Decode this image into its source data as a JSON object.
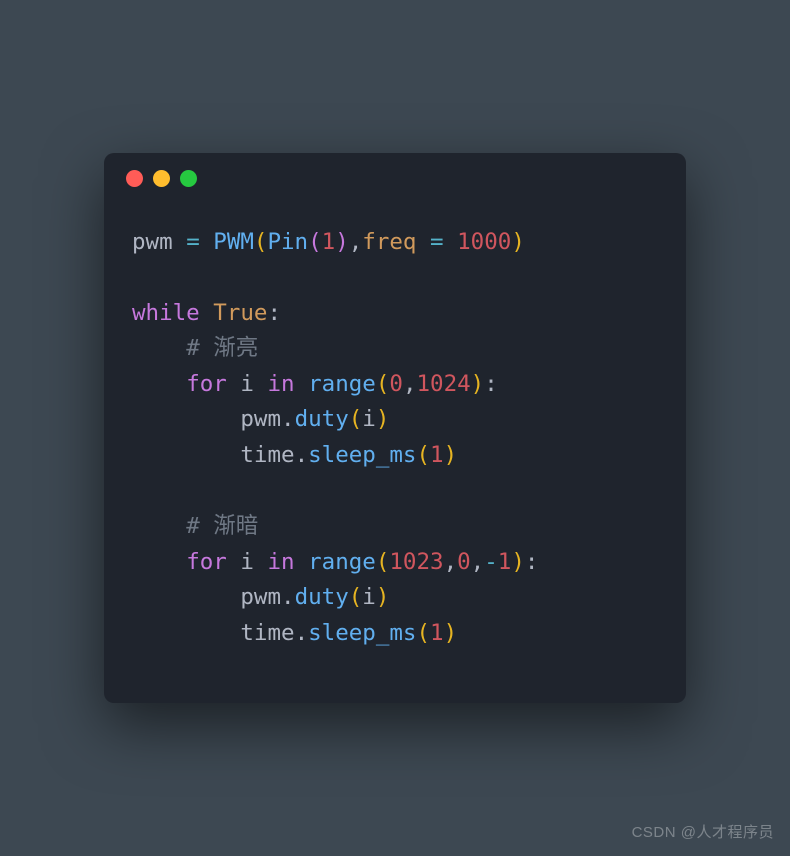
{
  "window": {
    "dot_red": "close",
    "dot_yellow": "min",
    "dot_green": "max"
  },
  "code": {
    "l1_pwm": "pwm",
    "l1_sp1": " ",
    "l1_eq": "=",
    "l1_sp2": " ",
    "l1_PWM": "PWM",
    "l1_open1": "(",
    "l1_Pin": "Pin",
    "l1_open2": "(",
    "l1_1a": "1",
    "l1_close2": ")",
    "l1_comma": ",",
    "l1_freq": "freq",
    "l1_sp3": " ",
    "l1_eq2": "=",
    "l1_sp4": " ",
    "l1_1000": "1000",
    "l1_close1": ")",
    "l3_while": "while",
    "l3_sp": " ",
    "l3_true": "True",
    "l3_colon": ":",
    "l4_indent": "    ",
    "l4_hash": "# ",
    "l4_text": "渐亮",
    "l5_indent": "    ",
    "l5_for": "for",
    "l5_sp1": " ",
    "l5_i": "i",
    "l5_sp2": " ",
    "l5_in": "in",
    "l5_sp3": " ",
    "l5_range": "range",
    "l5_open": "(",
    "l5_0": "0",
    "l5_comma": ",",
    "l5_1024": "1024",
    "l5_close": ")",
    "l5_colon": ":",
    "l6_indent": "        ",
    "l6_pwm": "pwm",
    "l6_dot": ".",
    "l6_duty": "duty",
    "l6_open": "(",
    "l6_i": "i",
    "l6_close": ")",
    "l7_indent": "        ",
    "l7_time": "time",
    "l7_dot": ".",
    "l7_sleep": "sleep_ms",
    "l7_open": "(",
    "l7_1": "1",
    "l7_close": ")",
    "l9_indent": "    ",
    "l9_hash": "# ",
    "l9_text": "渐暗",
    "l10_indent": "    ",
    "l10_for": "for",
    "l10_sp1": " ",
    "l10_i": "i",
    "l10_sp2": " ",
    "l10_in": "in",
    "l10_sp3": " ",
    "l10_range": "range",
    "l10_open": "(",
    "l10_1023": "1023",
    "l10_c1": ",",
    "l10_0": "0",
    "l10_c2": ",",
    "l10_neg": "-",
    "l10_1": "1",
    "l10_close": ")",
    "l10_colon": ":",
    "l11_indent": "        ",
    "l11_pwm": "pwm",
    "l11_dot": ".",
    "l11_duty": "duty",
    "l11_open": "(",
    "l11_i": "i",
    "l11_close": ")",
    "l12_indent": "        ",
    "l12_time": "time",
    "l12_dot": ".",
    "l12_sleep": "sleep_ms",
    "l12_open": "(",
    "l12_1": "1",
    "l12_close": ")"
  },
  "watermark": "CSDN @人才程序员"
}
